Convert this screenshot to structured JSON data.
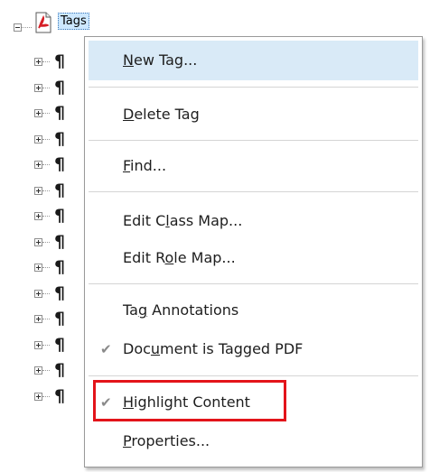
{
  "tree": {
    "root": {
      "label": "Tags",
      "expander": "minus",
      "icon": "pdf-document-icon"
    },
    "children": [
      {
        "symbol": "¶",
        "expander": "plus"
      },
      {
        "symbol": "¶",
        "expander": "plus"
      },
      {
        "symbol": "¶",
        "expander": "plus"
      },
      {
        "symbol": "¶",
        "expander": "plus"
      },
      {
        "symbol": "¶",
        "expander": "plus"
      },
      {
        "symbol": "¶",
        "expander": "plus"
      },
      {
        "symbol": "¶",
        "expander": "plus"
      },
      {
        "symbol": "¶",
        "expander": "plus"
      },
      {
        "symbol": "¶",
        "expander": "plus"
      },
      {
        "symbol": "¶",
        "expander": "plus"
      },
      {
        "symbol": "¶",
        "expander": "plus"
      },
      {
        "symbol": "¶",
        "expander": "plus"
      },
      {
        "symbol": "¶",
        "expander": "plus"
      },
      {
        "symbol": "¶",
        "expander": "plus"
      }
    ]
  },
  "context_menu": {
    "items": [
      {
        "pre": "",
        "u": "N",
        "post": "ew Tag...",
        "state": "highlighted",
        "checked": false
      },
      {
        "pre": "",
        "u": "D",
        "post": "elete Tag",
        "state": "enabled",
        "checked": false
      },
      {
        "pre": "",
        "u": "F",
        "post": "ind...",
        "state": "enabled",
        "checked": false
      },
      {
        "pre": "Edit C",
        "u": "l",
        "post": "ass Map...",
        "state": "enabled",
        "checked": false
      },
      {
        "pre": "Edit R",
        "u": "o",
        "post": "le Map...",
        "state": "enabled",
        "checked": false
      },
      {
        "pre": "Ta",
        "u": "g",
        "post": " Annotations",
        "state": "enabled",
        "checked": false
      },
      {
        "pre": "Doc",
        "u": "u",
        "post": "ment is Tagged PDF",
        "state": "enabled",
        "checked": true
      },
      {
        "pre": "",
        "u": "H",
        "post": "ighlight Content",
        "state": "enabled",
        "checked": true
      },
      {
        "pre": "",
        "u": "P",
        "post": "roperties...",
        "state": "enabled",
        "checked": false
      }
    ],
    "check_glyph": "✔"
  },
  "colors": {
    "highlight": "#d9eaf7",
    "annotation_box": "#e3141a",
    "root_selection": "#cde8ff"
  }
}
